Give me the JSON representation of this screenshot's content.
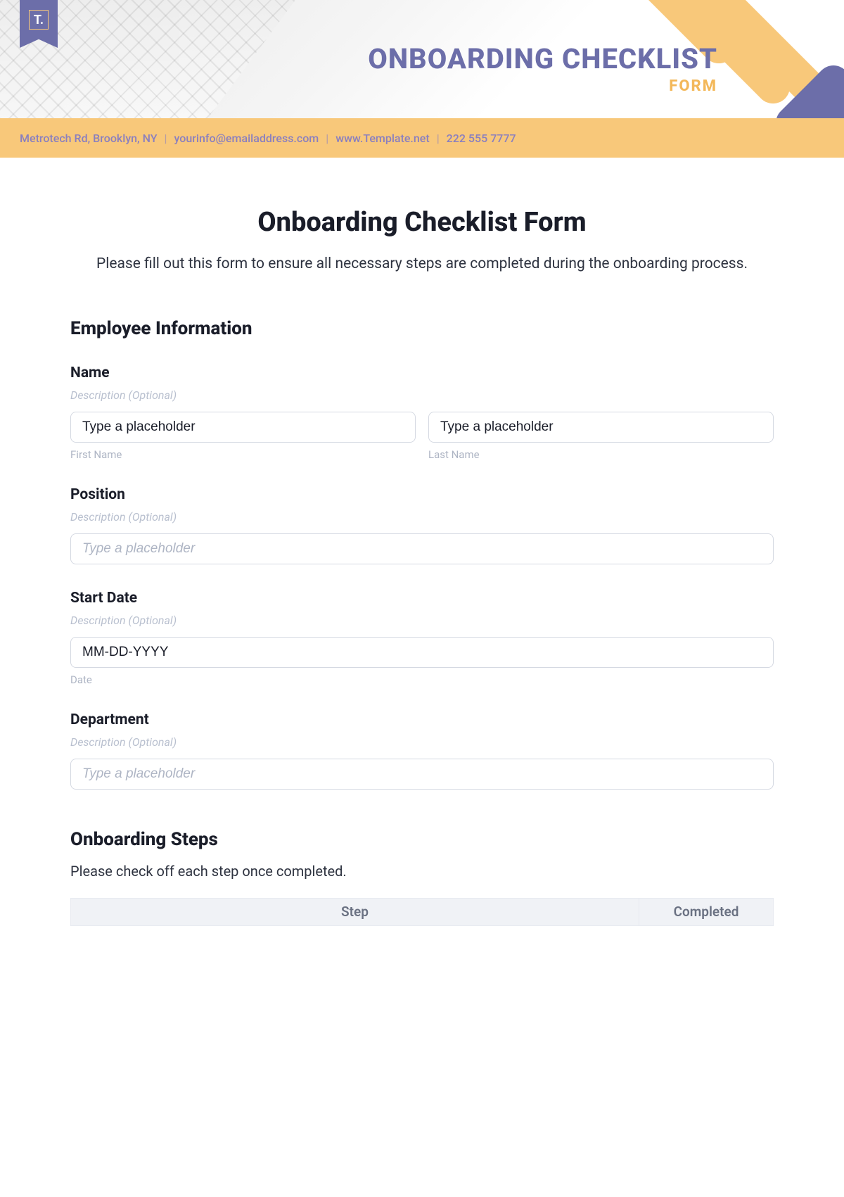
{
  "header": {
    "logo_text": "T.",
    "title_main": "ONBOARDING CHECKLIST",
    "title_sub": "FORM",
    "contact": {
      "address": "Metrotech Rd, Brooklyn, NY",
      "email": "yourinfo@emailaddress.com",
      "website": "www.Template.net",
      "phone": "222 555 7777"
    }
  },
  "page": {
    "title": "Onboarding Checklist Form",
    "description": "Please fill out this form to ensure all necessary steps are completed during the onboarding process."
  },
  "sections": {
    "employee_info": {
      "title": "Employee Information",
      "name": {
        "label": "Name",
        "desc": "Description (Optional)",
        "first_value": "Type a placeholder",
        "last_value": "Type a placeholder",
        "first_sub": "First Name",
        "last_sub": "Last Name"
      },
      "position": {
        "label": "Position",
        "desc": "Description (Optional)",
        "placeholder": "Type a placeholder"
      },
      "start_date": {
        "label": "Start Date",
        "desc": "Description (Optional)",
        "value": "MM-DD-YYYY",
        "sub": "Date"
      },
      "department": {
        "label": "Department",
        "desc": "Description (Optional)",
        "placeholder": "Type a placeholder"
      }
    },
    "onboarding_steps": {
      "title": "Onboarding Steps",
      "desc": "Please check off each step once completed.",
      "columns": {
        "step": "Step",
        "completed": "Completed"
      }
    }
  }
}
